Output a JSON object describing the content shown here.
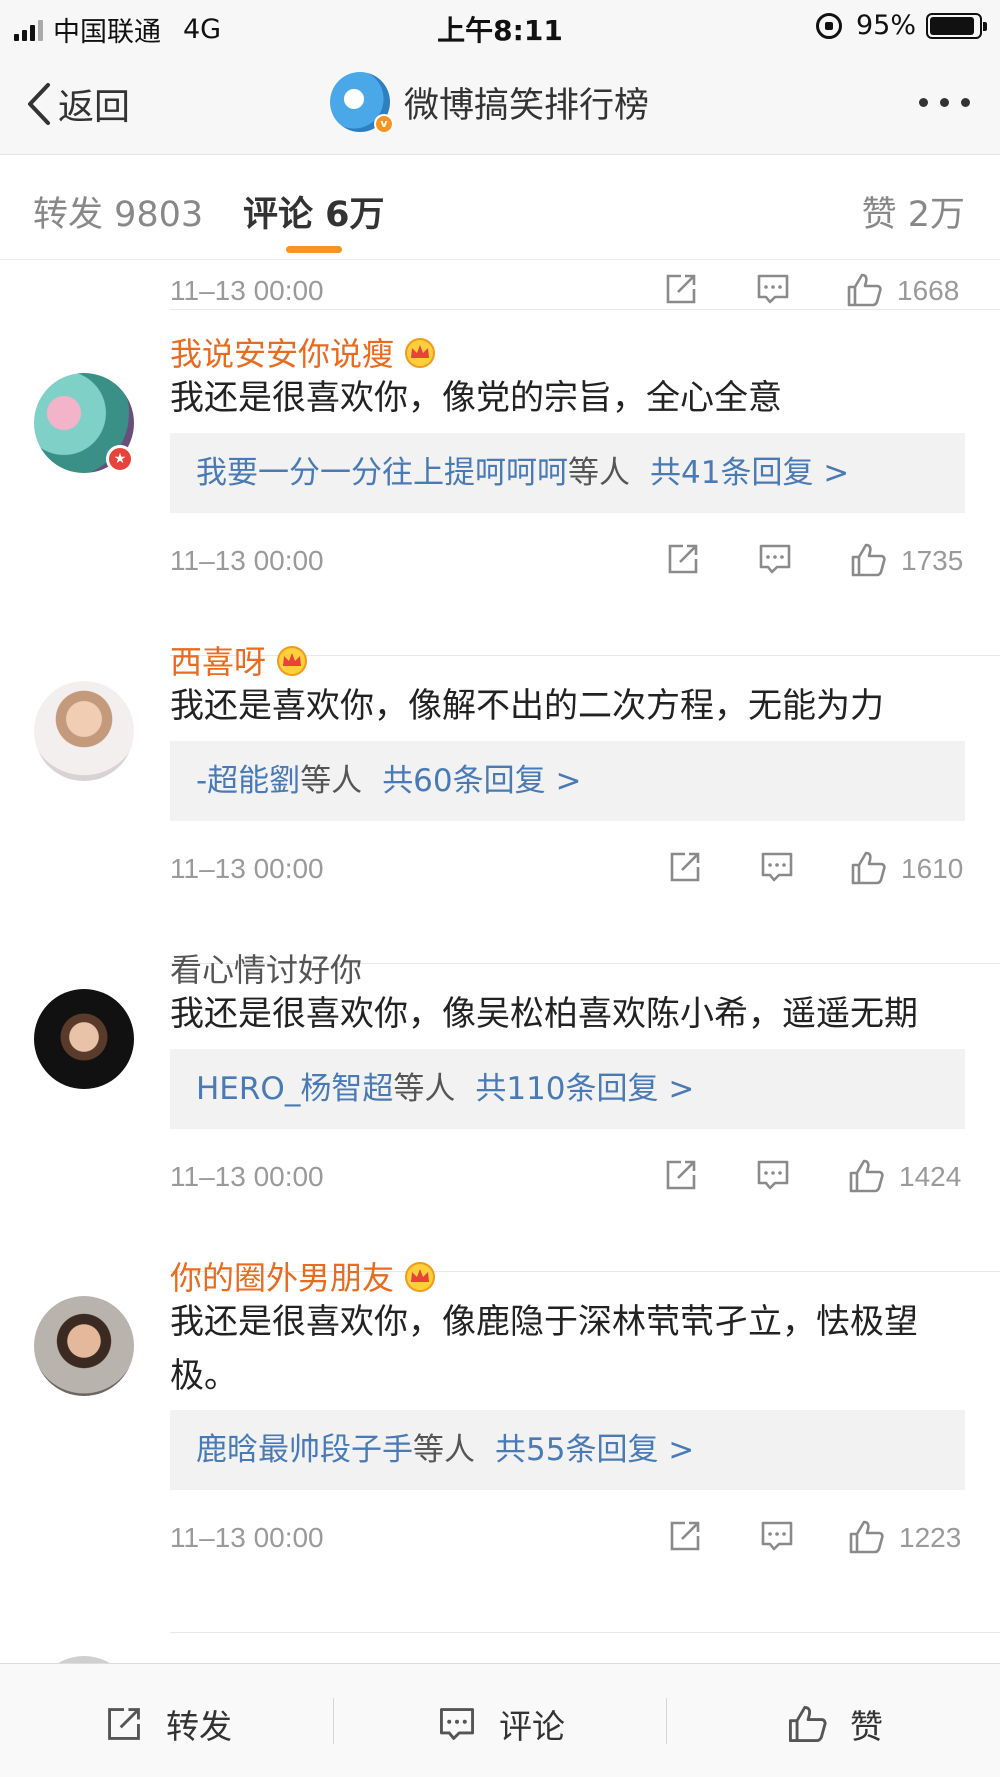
{
  "status_bar": {
    "carrier": "中国联通",
    "network": "4G",
    "time": "上午8:11",
    "battery": "95%"
  },
  "nav": {
    "back_label": "返回",
    "title": "微博搞笑排行榜"
  },
  "tabs": {
    "repost": "转发 9803",
    "comment": "评论 6万",
    "like": "赞 2万"
  },
  "comments": [
    {
      "time": "11–13 00:00",
      "likes": "1668"
    },
    {
      "username": "我说安安你说瘦",
      "text": "我还是很喜欢你，像党的宗旨，全心全意",
      "reply_who": "我要一分一分往上提呵呵呵",
      "reply_people": "等人",
      "reply_count": "共41条回复 >",
      "time": "11–13 00:00",
      "likes": "1735"
    },
    {
      "username": "西喜呀",
      "text": "我还是喜欢你，像解不出的二次方程，无能为力",
      "reply_who": "-超能劉",
      "reply_people": "等人",
      "reply_count": "共60条回复 >",
      "time": "11–13 00:00",
      "likes": "1610"
    },
    {
      "username": "看心情讨好你",
      "text": "我还是很喜欢你，像吴松柏喜欢陈小希，遥遥无期",
      "reply_who": "HERO_杨智超",
      "reply_people": "等人",
      "reply_count": "共110条回复 >",
      "time": "11–13 00:00",
      "likes": "1424"
    },
    {
      "username": "你的圈外男朋友",
      "text": "我还是很喜欢你，像鹿隐于深林茕茕孑立，怯极望极。",
      "reply_who": "鹿晗最帅段子手",
      "reply_people": "等人",
      "reply_count": "共55条回复 >",
      "time": "11–13 00:00",
      "likes": "1223"
    }
  ],
  "bottom_bar": {
    "repost": "转发",
    "comment": "评论",
    "like": "赞"
  },
  "colors": {
    "accent_orange": "#f7931e",
    "vip_name": "#e86b1f",
    "link_blue": "#4a7ab5"
  }
}
